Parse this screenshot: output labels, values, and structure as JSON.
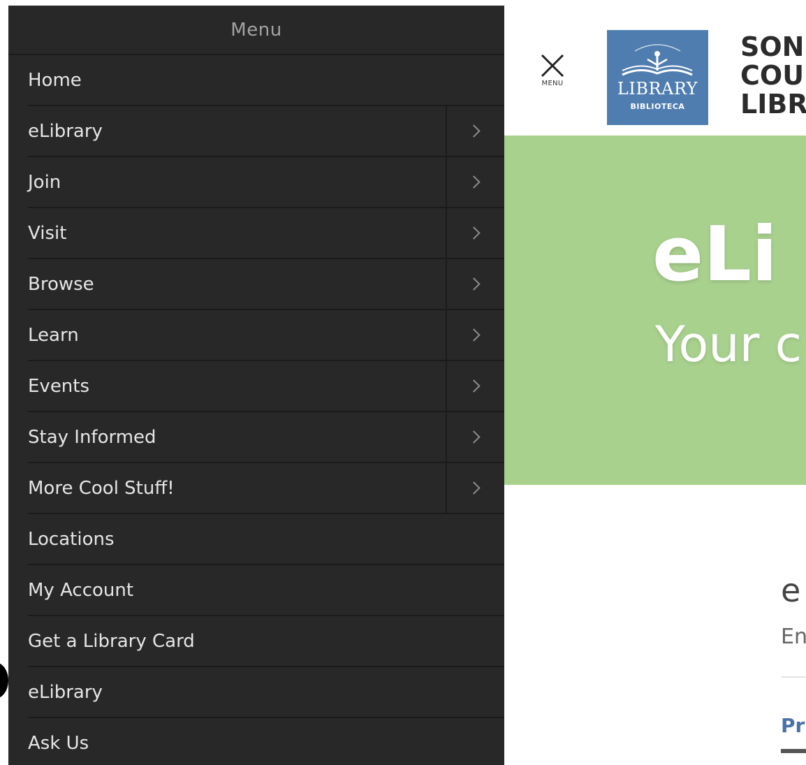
{
  "drawer": {
    "title": "Menu",
    "items": [
      {
        "label": "Home",
        "has_submenu": false
      },
      {
        "label": "eLibrary",
        "has_submenu": true
      },
      {
        "label": "Join",
        "has_submenu": true
      },
      {
        "label": "Visit",
        "has_submenu": true
      },
      {
        "label": "Browse",
        "has_submenu": true
      },
      {
        "label": "Learn",
        "has_submenu": true
      },
      {
        "label": "Events",
        "has_submenu": true
      },
      {
        "label": "Stay Informed",
        "has_submenu": true
      },
      {
        "label": "More Cool Stuff!",
        "has_submenu": true
      },
      {
        "label": "Locations",
        "has_submenu": false
      },
      {
        "label": "My Account",
        "has_submenu": false
      },
      {
        "label": "Get a Library Card",
        "has_submenu": false
      },
      {
        "label": "eLibrary",
        "has_submenu": false
      },
      {
        "label": "Ask Us",
        "has_submenu": false
      }
    ]
  },
  "header": {
    "close_caption": "MENU",
    "logo": {
      "arc_text": "SONOMA COUNTY",
      "main_text": "LIBRARY",
      "sub_text": "BIBLIOTECA"
    },
    "brand_lines": [
      "SON",
      "COU",
      "LIBR"
    ]
  },
  "hero": {
    "title": "eLi",
    "subtitle": "Your c"
  },
  "content": {
    "heading": "e",
    "text": "En",
    "tab_label": "Pr"
  },
  "colors": {
    "drawer_bg": "#282828",
    "hero_bg": "#a9d18e",
    "logo_bg": "#4f7db0",
    "tab_accent": "#4a72a8"
  }
}
